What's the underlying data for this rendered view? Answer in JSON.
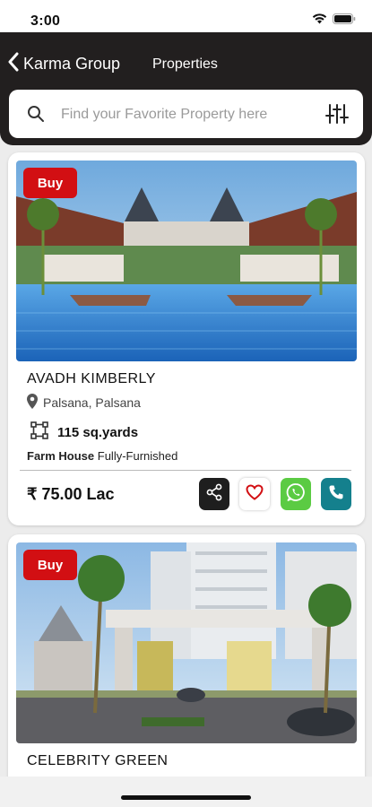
{
  "status_bar": {
    "time": "3:00"
  },
  "header": {
    "back_label": "Karma Group",
    "title": "Properties"
  },
  "search": {
    "placeholder": "Find your Favorite Property here"
  },
  "listings": [
    {
      "badge": "Buy",
      "name": "AVADH KIMBERLY",
      "location": "Palsana, Palsana",
      "area": "115 sq.yards",
      "type": "Farm House",
      "furnishing": "Fully-Furnished",
      "price": "₹ 75.00 Lac"
    },
    {
      "badge": "Buy",
      "name": "CELEBRITY GREEN"
    }
  ],
  "colors": {
    "header_bg": "#221f1f",
    "badge": "#d20f13",
    "whatsapp": "#5bcb43",
    "call": "#14808d",
    "favorite": "#d20f13"
  },
  "icons": [
    "back-chevron-icon",
    "search-icon",
    "filter-sliders-icon",
    "location-pin-icon",
    "area-icon",
    "share-icon",
    "heart-icon",
    "whatsapp-icon",
    "phone-icon",
    "wifi-icon",
    "battery-icon"
  ]
}
